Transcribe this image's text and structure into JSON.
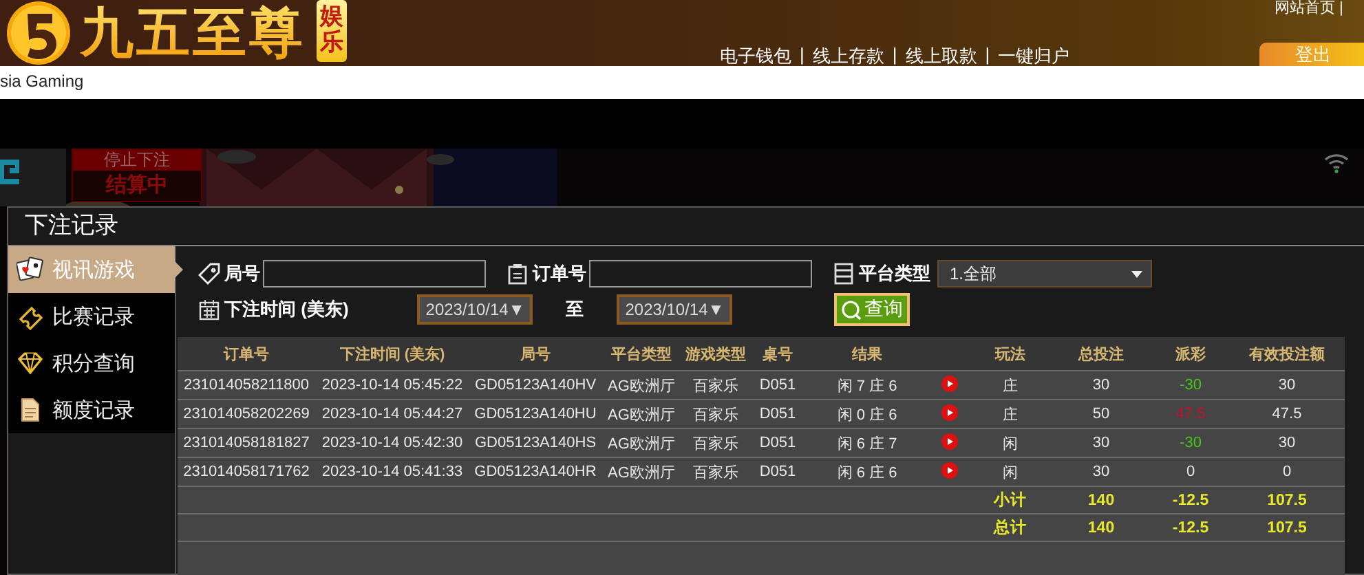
{
  "header": {
    "logo_text": "九五至尊",
    "logo_badge": "娱乐",
    "top_link": "网站首页",
    "top_separator": "|",
    "nav": [
      "电子钱包",
      "线上存款",
      "线上取款",
      "一键归户"
    ],
    "logout": "登出"
  },
  "provider_bar": {
    "text": "sia Gaming"
  },
  "game": {
    "status_title": "停止下注",
    "status": "结算中"
  },
  "modal": {
    "title": "下注记录",
    "sidebar": [
      {
        "label": "视讯游戏",
        "selected": true
      },
      {
        "label": "比赛记录",
        "selected": false
      },
      {
        "label": "积分查询",
        "selected": false
      },
      {
        "label": "额度记录",
        "selected": false
      }
    ],
    "filters": {
      "round_label": "局号",
      "order_label": "订单号",
      "platform_label": "平台类型",
      "platform_value": "1.全部",
      "time_label": "下注时间 (美东)",
      "date_from": "2023/10/14▼",
      "to_label": "至",
      "date_to": "2023/10/14▼",
      "query_button": "查询"
    },
    "table": {
      "columns": [
        "订单号",
        "下注时间 (美东)",
        "局号",
        "平台类型",
        "游戏类型",
        "桌号",
        "结果",
        "玩法",
        "总投注",
        "派彩",
        "有效投注额"
      ],
      "rows": [
        {
          "order": "231014058211800",
          "time": "2023-10-14 05:45:22",
          "round": "GD05123A140HV",
          "platform": "AG欧洲厅",
          "game": "百家乐",
          "table": "D051",
          "result": "闲 7 庄 6",
          "video": true,
          "bet_type": "庄",
          "stake": "30",
          "payout": "-30",
          "color": "#47c71a",
          "valid": "30"
        },
        {
          "order": "231014058202269",
          "time": "2023-10-14 05:44:27",
          "round": "GD05123A140HU",
          "platform": "AG欧洲厅",
          "game": "百家乐",
          "table": "D051",
          "result": "闲 0 庄 6",
          "video": true,
          "bet_type": "庄",
          "stake": "50",
          "payout": "47.5",
          "color": "#c8102e",
          "valid": "47.5"
        },
        {
          "order": "231014058181827",
          "time": "2023-10-14 05:42:30",
          "round": "GD05123A140HS",
          "platform": "AG欧洲厅",
          "game": "百家乐",
          "table": "D051",
          "result": "闲 6 庄 7",
          "video": true,
          "bet_type": "闲",
          "stake": "30",
          "payout": "-30",
          "color": "#47c71a",
          "valid": "30"
        },
        {
          "order": "231014058171762",
          "time": "2023-10-14 05:41:33",
          "round": "GD05123A140HR",
          "platform": "AG欧洲厅",
          "game": "百家乐",
          "table": "D051",
          "result": "闲 6 庄 6",
          "video": true,
          "bet_type": "闲",
          "stake": "30",
          "payout": "0",
          "color": "#e6e6e6",
          "valid": "0"
        }
      ],
      "totals": [
        {
          "label": "小计",
          "stake": "140",
          "payout": "-12.5",
          "valid": "107.5"
        },
        {
          "label": "总计",
          "stake": "140",
          "payout": "-12.5",
          "valid": "107.5"
        }
      ]
    }
  }
}
